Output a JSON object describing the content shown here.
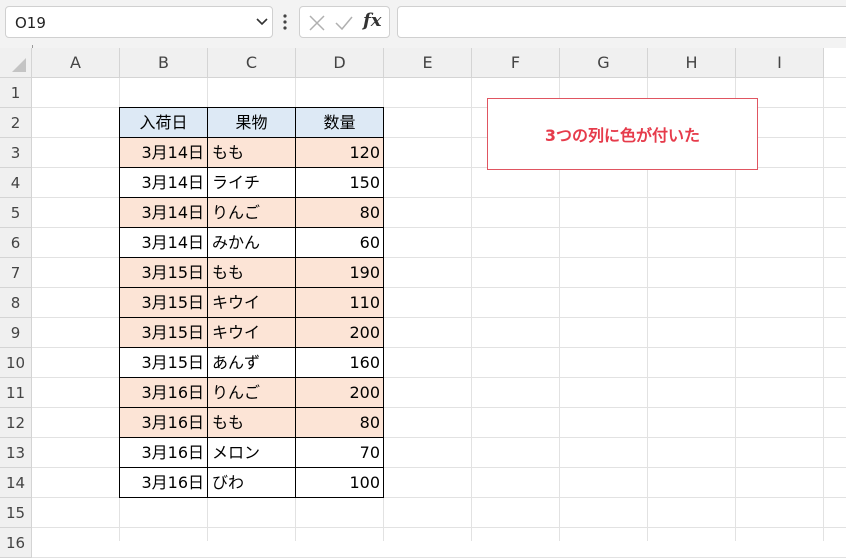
{
  "app": {
    "name_box": "O19",
    "formula_value": ""
  },
  "icons": {
    "name_box_dropdown": "chevron-down-icon",
    "more": "vertical-dots-icon",
    "cancel": "x-icon",
    "enter": "check-icon",
    "function": "fx-icon"
  },
  "formula_bar": {
    "fx_label": "fx"
  },
  "columns": [
    "A",
    "B",
    "C",
    "D",
    "E",
    "F",
    "G",
    "H",
    "I"
  ],
  "rows": [
    "1",
    "2",
    "3",
    "4",
    "5",
    "6",
    "7",
    "8",
    "9",
    "10",
    "11",
    "12",
    "13",
    "14",
    "15",
    "16"
  ],
  "table": {
    "headers": [
      "入荷日",
      "果物",
      "数量"
    ],
    "rows": [
      {
        "date": "3月14日",
        "fruit": "もも",
        "qty": "120",
        "highlight": true
      },
      {
        "date": "3月14日",
        "fruit": "ライチ",
        "qty": "150",
        "highlight": false
      },
      {
        "date": "3月14日",
        "fruit": "りんご",
        "qty": "80",
        "highlight": true
      },
      {
        "date": "3月14日",
        "fruit": "みかん",
        "qty": "60",
        "highlight": false
      },
      {
        "date": "3月15日",
        "fruit": "もも",
        "qty": "190",
        "highlight": true
      },
      {
        "date": "3月15日",
        "fruit": "キウイ",
        "qty": "110",
        "highlight": true
      },
      {
        "date": "3月15日",
        "fruit": "キウイ",
        "qty": "200",
        "highlight": true
      },
      {
        "date": "3月15日",
        "fruit": "あんず",
        "qty": "160",
        "highlight": false
      },
      {
        "date": "3月16日",
        "fruit": "りんご",
        "qty": "200",
        "highlight": true
      },
      {
        "date": "3月16日",
        "fruit": "もも",
        "qty": "80",
        "highlight": true
      },
      {
        "date": "3月16日",
        "fruit": "メロン",
        "qty": "70",
        "highlight": false
      },
      {
        "date": "3月16日",
        "fruit": "びわ",
        "qty": "100",
        "highlight": false
      }
    ]
  },
  "note": {
    "text": "3つの列に色が付いた"
  },
  "colors": {
    "header_fill": "#dde9f5",
    "highlight_fill": "#fce4d6",
    "note_border": "#e05561",
    "note_text": "#e63b4b"
  }
}
